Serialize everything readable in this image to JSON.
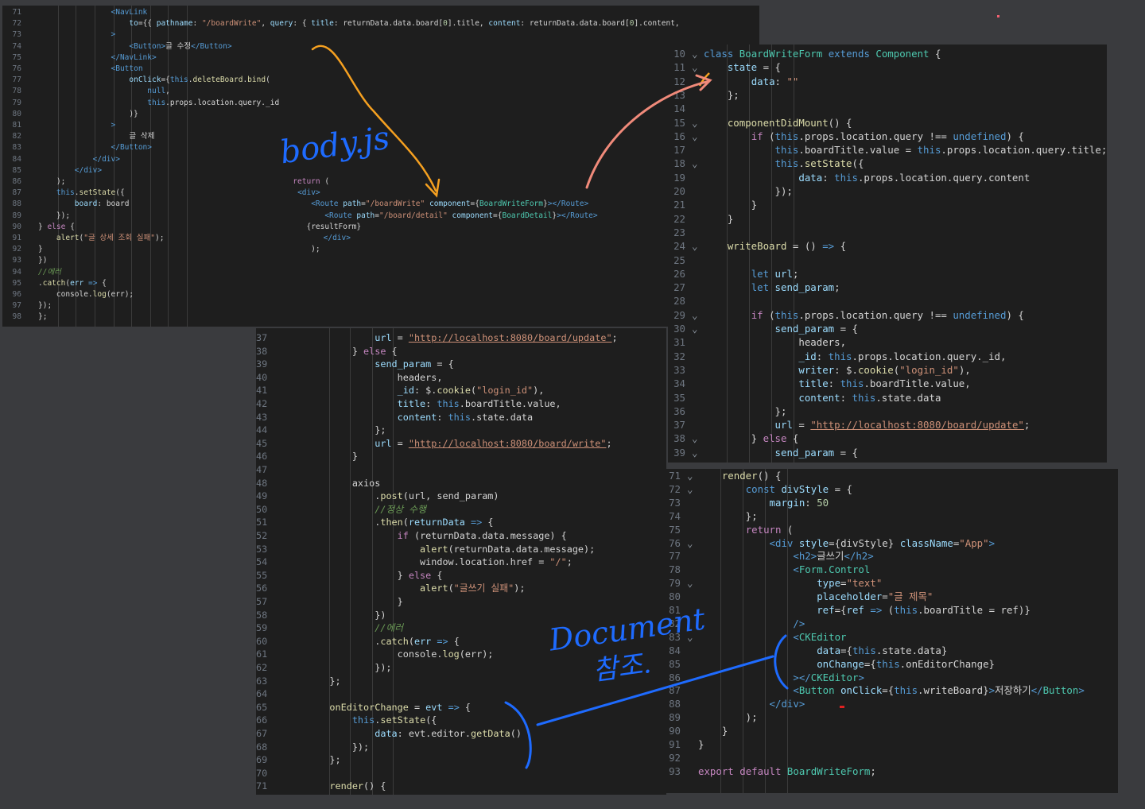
{
  "annotations": {
    "body_js": "body.js",
    "document_ref": "Document",
    "document_ref_korean": "참조."
  },
  "colors": {
    "arrow_orange": "#f5a020",
    "arrow_pink": "#f08a7a",
    "ink_blue": "#1e6bff"
  },
  "panel1": {
    "lines": [
      {
        "n": "71",
        "h": "                <span class=\"tag\">&lt;NavLink</span>"
      },
      {
        "n": "72",
        "h": "                    <span class=\"attr\">to</span>={{ <span class=\"var\">pathname</span>: <span class=\"str\">\"/boardWrite\"</span>, <span class=\"var\">query</span>: { <span class=\"var\">title</span>: returnData.data.board[<span class=\"num\">0</span>].title, <span class=\"var\">content</span>: returnData.data.board[<span class=\"num\">0</span>].content,"
      },
      {
        "n": "73",
        "h": "                <span class=\"tag\">&gt;</span>"
      },
      {
        "n": "74",
        "h": "                    <span class=\"tag\">&lt;Button&gt;</span>글 수정<span class=\"tag\">&lt;/Button&gt;</span>"
      },
      {
        "n": "75",
        "h": "                <span class=\"tag\">&lt;/NavLink&gt;</span>"
      },
      {
        "n": "76",
        "h": "                <span class=\"tag\">&lt;Button</span>"
      },
      {
        "n": "77",
        "h": "                    <span class=\"attr\">onClick</span>={<span class=\"kw\">this</span>.<span class=\"fn\">deleteBoard</span>.<span class=\"fn\">bind</span>("
      },
      {
        "n": "78",
        "h": "                        <span class=\"kw\">null</span>,"
      },
      {
        "n": "79",
        "h": "                        <span class=\"kw\">this</span>.props.location.query._id"
      },
      {
        "n": "80",
        "h": "                    )}"
      },
      {
        "n": "81",
        "h": "                <span class=\"tag\">&gt;</span>"
      },
      {
        "n": "82",
        "h": "                    글 삭제"
      },
      {
        "n": "83",
        "h": "                <span class=\"tag\">&lt;/Button&gt;</span>"
      },
      {
        "n": "84",
        "h": "            <span class=\"tag\">&lt;/div&gt;</span>"
      },
      {
        "n": "85",
        "h": "        <span class=\"tag\">&lt;/div&gt;</span>"
      },
      {
        "n": "86",
        "h": "    );                                                  <span class=\"ctl\">return</span> ("
      },
      {
        "n": "87",
        "h": "    <span class=\"kw\">this</span>.<span class=\"fn\">setState</span>({                                      <span class=\"tag\">&lt;div&gt;</span>"
      },
      {
        "n": "88",
        "h": "        <span class=\"var\">board</span>: board                                        <span class=\"tag\">&lt;Route</span> <span class=\"attr\">path</span>=<span class=\"str\">\"/boardWrite\"</span> <span class=\"attr\">component</span>={<span class=\"cls\">BoardWriteForm</span>}<span class=\"tag\">&gt;&lt;/Route&gt;</span>"
      },
      {
        "n": "89",
        "h": "    });                                                        <span class=\"tag\">&lt;Route</span> <span class=\"attr\">path</span>=<span class=\"str\">\"/board/detail\"</span> <span class=\"attr\">component</span>={<span class=\"cls\">BoardDetail</span>}<span class=\"tag\">&gt;&lt;/Route&gt;</span>"
      },
      {
        "n": "90",
        "h": "} <span class=\"ctl\">else</span> {                                                   {resultForm}"
      },
      {
        "n": "91",
        "h": "    <span class=\"fn\">alert</span>(<span class=\"str\">\"글 상세 조회 실패\"</span>);                                   <span class=\"tag\">&lt;/div&gt;</span>"
      },
      {
        "n": "92",
        "h": "}                                                           );"
      },
      {
        "n": "93",
        "h": "})"
      },
      {
        "n": "94",
        "h": "<span class=\"cmt\">//에러</span>"
      },
      {
        "n": "95",
        "h": ".<span class=\"fn\">catch</span>(<span class=\"var\">err</span> <span class=\"kw\">=&gt;</span> {"
      },
      {
        "n": "96",
        "h": "    console.<span class=\"fn\">log</span>(err);"
      },
      {
        "n": "97",
        "h": "});"
      },
      {
        "n": "98",
        "h": "};"
      }
    ]
  },
  "panel2": {
    "lines": [
      {
        "n": "37",
        "h": "            <span class=\"var\">url</span> = <span class=\"str u\">\"http://localhost:8080/board/update\"</span>;"
      },
      {
        "n": "38",
        "h": "        } <span class=\"ctl\">else</span> {"
      },
      {
        "n": "39",
        "h": "            <span class=\"var\">send_param</span> = {"
      },
      {
        "n": "40",
        "h": "                headers,"
      },
      {
        "n": "41",
        "h": "                <span class=\"var\">_id</span>: $.<span class=\"fn\">cookie</span>(<span class=\"str\">\"login_id\"</span>),"
      },
      {
        "n": "42",
        "h": "                <span class=\"var\">title</span>: <span class=\"kw\">this</span>.boardTitle.value,"
      },
      {
        "n": "43",
        "h": "                <span class=\"var\">content</span>: <span class=\"kw\">this</span>.state.data"
      },
      {
        "n": "44",
        "h": "            };"
      },
      {
        "n": "45",
        "h": "            <span class=\"var\">url</span> = <span class=\"str u\">\"http://localhost:8080/board/write\"</span>;"
      },
      {
        "n": "46",
        "h": "        }"
      },
      {
        "n": "47",
        "h": ""
      },
      {
        "n": "48",
        "h": "        axios"
      },
      {
        "n": "49",
        "h": "            .<span class=\"fn\">post</span>(url, send_param)"
      },
      {
        "n": "50",
        "h": "            <span class=\"cmt\">//정상 수행</span>"
      },
      {
        "n": "51",
        "h": "            .<span class=\"fn\">then</span>(<span class=\"var\">returnData</span> <span class=\"kw\">=&gt;</span> {"
      },
      {
        "n": "52",
        "h": "                <span class=\"ctl\">if</span> (returnData.data.message) {"
      },
      {
        "n": "53",
        "h": "                    <span class=\"fn\">alert</span>(returnData.data.message);"
      },
      {
        "n": "54",
        "h": "                    window.location.href = <span class=\"str\">\"/\"</span>;"
      },
      {
        "n": "55",
        "h": "                } <span class=\"ctl\">else</span> {"
      },
      {
        "n": "56",
        "h": "                    <span class=\"fn\">alert</span>(<span class=\"str\">\"글쓰기 실패\"</span>);"
      },
      {
        "n": "57",
        "h": "                }"
      },
      {
        "n": "58",
        "h": "            })"
      },
      {
        "n": "59",
        "h": "            <span class=\"cmt\">//에러</span>"
      },
      {
        "n": "60",
        "h": "            .<span class=\"fn\">catch</span>(<span class=\"var\">err</span> <span class=\"kw\">=&gt;</span> {"
      },
      {
        "n": "61",
        "h": "                console.<span class=\"fn\">log</span>(err);"
      },
      {
        "n": "62",
        "h": "            });"
      },
      {
        "n": "63",
        "h": "    };"
      },
      {
        "n": "64",
        "h": ""
      },
      {
        "n": "65",
        "h": "    <span class=\"fn\">onEditorChange</span> = <span class=\"var\">evt</span> <span class=\"kw\">=&gt;</span> {"
      },
      {
        "n": "66",
        "h": "        <span class=\"kw\">this</span>.<span class=\"fn\">setState</span>({"
      },
      {
        "n": "67",
        "h": "            <span class=\"var\">data</span>: evt.editor.<span class=\"fn\">getData</span>()"
      },
      {
        "n": "68",
        "h": "        });"
      },
      {
        "n": "69",
        "h": "    };"
      },
      {
        "n": "70",
        "h": ""
      },
      {
        "n": "71",
        "h": "    <span class=\"fn\">render</span>() {"
      }
    ]
  },
  "panel3": {
    "lines": [
      {
        "n": "10",
        "f": "v",
        "h": "<span class=\"kw\">class</span> <span class=\"cls\">BoardWriteForm</span> <span class=\"kw\">extends</span> <span class=\"cls\">Component</span> {"
      },
      {
        "n": "11",
        "f": "v",
        "h": "    <span class=\"var\">state</span> = {"
      },
      {
        "n": "12",
        "f": "",
        "h": "        <span class=\"var\">data</span>: <span class=\"str\">\"\"</span>"
      },
      {
        "n": "13",
        "f": "",
        "h": "    };"
      },
      {
        "n": "14",
        "f": "",
        "h": ""
      },
      {
        "n": "15",
        "f": "v",
        "h": "    <span class=\"fn\">componentDidMount</span>() {"
      },
      {
        "n": "16",
        "f": "v",
        "h": "        <span class=\"ctl\">if</span> (<span class=\"kw\">this</span>.props.location.query !== <span class=\"kw\">undefined</span>) {"
      },
      {
        "n": "17",
        "f": "",
        "h": "            <span class=\"kw\">this</span>.boardTitle.value = <span class=\"kw\">this</span>.props.location.query.title;"
      },
      {
        "n": "18",
        "f": "v",
        "h": "            <span class=\"kw\">this</span>.<span class=\"fn\">setState</span>({"
      },
      {
        "n": "19",
        "f": "",
        "h": "                <span class=\"var\">data</span>: <span class=\"kw\">this</span>.props.location.query.content"
      },
      {
        "n": "20",
        "f": "",
        "h": "            });"
      },
      {
        "n": "21",
        "f": "",
        "h": "        }"
      },
      {
        "n": "22",
        "f": "",
        "h": "    }"
      },
      {
        "n": "23",
        "f": "",
        "h": ""
      },
      {
        "n": "24",
        "f": "v",
        "h": "    <span class=\"fn\">writeBoard</span> = () <span class=\"kw\">=&gt;</span> {"
      },
      {
        "n": "25",
        "f": "",
        "h": ""
      },
      {
        "n": "26",
        "f": "",
        "h": "        <span class=\"kw\">let</span> <span class=\"var\">url</span>;"
      },
      {
        "n": "27",
        "f": "",
        "h": "        <span class=\"kw\">let</span> <span class=\"var\">send_param</span>;"
      },
      {
        "n": "28",
        "f": "",
        "h": ""
      },
      {
        "n": "29",
        "f": "v",
        "h": "        <span class=\"ctl\">if</span> (<span class=\"kw\">this</span>.props.location.query !== <span class=\"kw\">undefined</span>) {"
      },
      {
        "n": "30",
        "f": "v",
        "h": "            <span class=\"var\">send_param</span> = {"
      },
      {
        "n": "31",
        "f": "",
        "h": "                headers,"
      },
      {
        "n": "32",
        "f": "",
        "h": "                <span class=\"var\">_id</span>: <span class=\"kw\">this</span>.props.location.query._id,"
      },
      {
        "n": "33",
        "f": "",
        "h": "                <span class=\"var\">writer</span>: $.<span class=\"fn\">cookie</span>(<span class=\"str\">\"login_id\"</span>),"
      },
      {
        "n": "34",
        "f": "",
        "h": "                <span class=\"var\">title</span>: <span class=\"kw\">this</span>.boardTitle.value,"
      },
      {
        "n": "35",
        "f": "",
        "h": "                <span class=\"var\">content</span>: <span class=\"kw\">this</span>.state.data"
      },
      {
        "n": "36",
        "f": "",
        "h": "            };"
      },
      {
        "n": "37",
        "f": "",
        "h": "            <span class=\"var\">url</span> = <span class=\"str u\">\"http://localhost:8080/board/update\"</span>;"
      },
      {
        "n": "38",
        "f": "v",
        "h": "        } <span class=\"ctl\">else</span> {"
      },
      {
        "n": "39",
        "f": "v",
        "h": "            <span class=\"var\">send_param</span> = {"
      }
    ]
  },
  "panel4": {
    "lines": [
      {
        "n": "71",
        "f": "v",
        "h": "    <span class=\"fn\">render</span>() {"
      },
      {
        "n": "72",
        "f": "v",
        "h": "        <span class=\"kw\">const</span> <span class=\"var\">divStyle</span> = {"
      },
      {
        "n": "73",
        "f": "",
        "h": "            <span class=\"var\">margin</span>: <span class=\"num\">50</span>"
      },
      {
        "n": "74",
        "f": "",
        "h": "        };"
      },
      {
        "n": "75",
        "f": "",
        "h": "        <span class=\"ctl\">return</span> ("
      },
      {
        "n": "76",
        "f": "v",
        "h": "            <span class=\"tag\">&lt;div</span> <span class=\"attr\">style</span>={divStyle} <span class=\"attr\">className</span>=<span class=\"str\">\"App\"</span><span class=\"tag\">&gt;</span>"
      },
      {
        "n": "77",
        "f": "",
        "h": "                <span class=\"tag\">&lt;h2&gt;</span>글쓰기<span class=\"tag\">&lt;/h2&gt;</span>"
      },
      {
        "n": "78",
        "f": "",
        "h": "                <span class=\"tag\">&lt;</span><span class=\"cls\">Form.Control</span>"
      },
      {
        "n": "79",
        "f": "v",
        "h": "                    <span class=\"attr\">type</span>=<span class=\"str\">\"text\"</span>"
      },
      {
        "n": "80",
        "f": "",
        "h": "                    <span class=\"attr\">placeholder</span>=<span class=\"str\">\"글 제목\"</span>"
      },
      {
        "n": "81",
        "f": "",
        "h": "                    <span class=\"attr\">ref</span>={<span class=\"var\">ref</span> <span class=\"kw\">=&gt;</span> (<span class=\"kw\">this</span>.boardTitle = ref)}"
      },
      {
        "n": "82",
        "f": "",
        "h": "                <span class=\"tag\">/&gt;</span>"
      },
      {
        "n": "83",
        "f": "v",
        "h": "                <span class=\"tag\">&lt;</span><span class=\"cls\">CKEditor</span>"
      },
      {
        "n": "84",
        "f": "",
        "h": "                    <span class=\"attr\">data</span>={<span class=\"kw\">this</span>.state.data}"
      },
      {
        "n": "85",
        "f": "",
        "h": "                    <span class=\"attr\">onChange</span>={<span class=\"kw\">this</span>.onEditorChange}"
      },
      {
        "n": "86",
        "f": "",
        "h": "                <span class=\"tag\">&gt;&lt;/</span><span class=\"cls\">CKEditor</span><span class=\"tag\">&gt;</span>"
      },
      {
        "n": "87",
        "f": "",
        "h": "                <span class=\"tag\">&lt;</span><span class=\"cls\">Button</span> <span class=\"attr\">onClick</span>={<span class=\"kw\">this</span>.writeBoard}<span class=\"tag\">&gt;</span>저장하기<span class=\"tag\">&lt;/</span><span class=\"cls\">Button</span><span class=\"tag\">&gt;</span>"
      },
      {
        "n": "88",
        "f": "",
        "h": "            <span class=\"tag\">&lt;/div&gt;</span>"
      },
      {
        "n": "89",
        "f": "",
        "h": "        );"
      },
      {
        "n": "90",
        "f": "",
        "h": "    }"
      },
      {
        "n": "91",
        "f": "",
        "h": "}"
      },
      {
        "n": "92",
        "f": "",
        "h": ""
      },
      {
        "n": "93",
        "f": "",
        "h": "<span class=\"ctl\">export</span> <span class=\"ctl\">default</span> <span class=\"cls\">BoardWriteForm</span>;"
      }
    ]
  }
}
